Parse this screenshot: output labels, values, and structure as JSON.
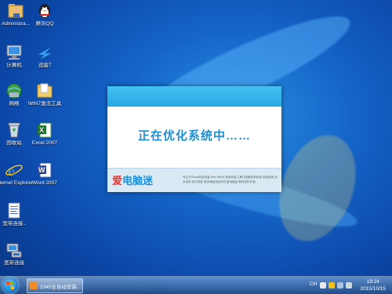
{
  "desktop": {
    "icons": [
      {
        "label": "Administra...",
        "icon": "user-folder-icon"
      },
      {
        "label": "腾讯QQ",
        "icon": "qq-penguin-icon"
      },
      {
        "label": "计算机",
        "icon": "computer-icon"
      },
      {
        "label": "迅雷7",
        "icon": "thunder-icon"
      },
      {
        "label": "网络",
        "icon": "network-icon"
      },
      {
        "label": "WIN7激活工具",
        "icon": "folder-icon"
      },
      {
        "label": "回收站",
        "icon": "recycle-bin-icon"
      },
      {
        "label": "Excel 2007",
        "icon": "excel-icon"
      },
      {
        "label": "Internet Explorer",
        "icon": "internet-explorer-icon"
      },
      {
        "label": "Word 2007",
        "icon": "word-icon"
      },
      {
        "label": "宽带连接..",
        "icon": "document-icon"
      },
      {
        "label": "宽带连接",
        "icon": "broadband-icon"
      }
    ]
  },
  "dialog": {
    "message": "正在优化系统中……",
    "logo_part1": "爱",
    "logo_part2": "电脑迷",
    "info": "专注于Ghost系统封装 Win7/Win8 系统安装工具打造最优质系统 欢迎使用 技术支持 官方网站 更多精品系统尽在爱电脑迷 期待您的光临"
  },
  "taskbar": {
    "task_label": "2345全自动安装...",
    "lang": "CH",
    "time": "19:24",
    "date": "2015/10/15"
  },
  "colors": {
    "accent": "#27a8e6",
    "message": "#1a8fd6"
  }
}
